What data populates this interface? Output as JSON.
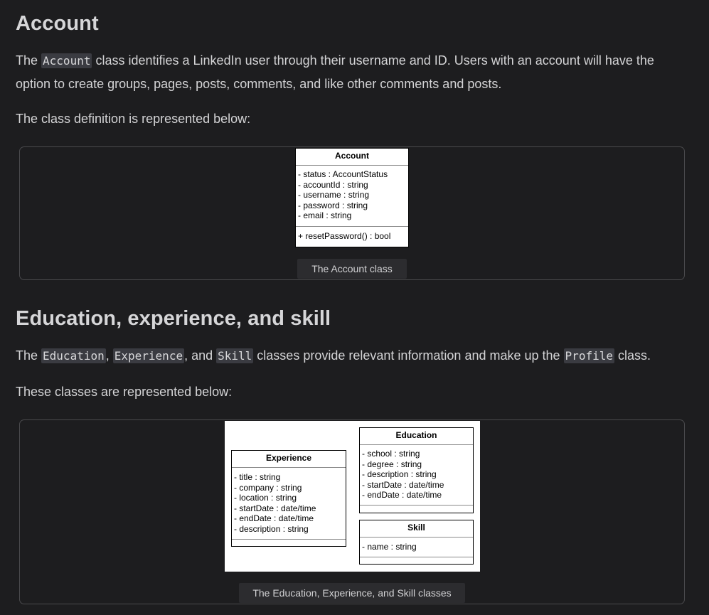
{
  "account_section": {
    "heading": "Account",
    "para1": {
      "before": "The ",
      "code": "Account",
      "after": " class identifies a LinkedIn user through their username and ID. Users with an account will have the option to create groups, pages, posts, comments, and like other comments and posts."
    },
    "para2": "The class definition is represented below:",
    "diagram": {
      "class_name": "Account",
      "attributes": [
        "- status : AccountStatus",
        "- accountId : string",
        "- username : string",
        "- password : string",
        "- email : string"
      ],
      "methods": [
        "+ resetPassword() : bool"
      ]
    },
    "caption": "The Account class"
  },
  "education_section": {
    "heading": "Education, experience, and skill",
    "para1": {
      "t1": "The ",
      "c1": "Education",
      "t2": ", ",
      "c2": "Experience",
      "t3": ", and ",
      "c3": "Skill",
      "t4": " classes provide relevant information and make up the ",
      "c4": "Profile",
      "t5": " class."
    },
    "para2": "These classes are represented below:",
    "diagram": {
      "experience": {
        "class_name": "Experience",
        "attributes": [
          "- title : string",
          "- company : string",
          "- location : string",
          "- startDate : date/time",
          "- endDate : date/time",
          "- description : string"
        ]
      },
      "education": {
        "class_name": "Education",
        "attributes": [
          "- school : string",
          "- degree : string",
          "- description : string",
          "- startDate : date/time",
          "- endDate : date/time"
        ]
      },
      "skill": {
        "class_name": "Skill",
        "attributes": [
          "- name : string"
        ]
      }
    },
    "caption": "The Education, Experience, and Skill classes"
  }
}
